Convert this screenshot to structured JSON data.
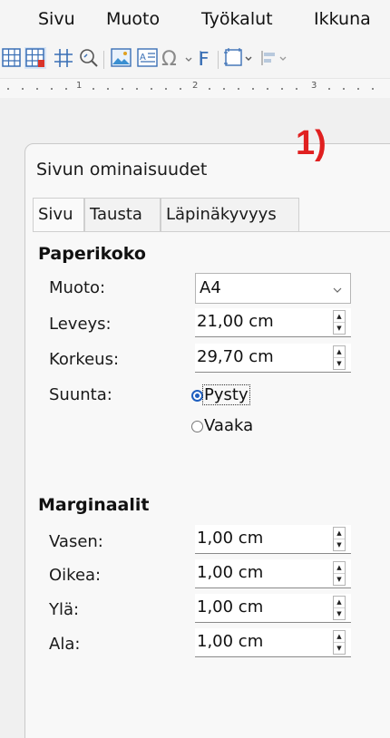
{
  "menubar": {
    "items": [
      "Sivu",
      "Muoto",
      "Työkalut",
      "Ikkuna"
    ]
  },
  "toolbar": {
    "icons": [
      "table-grid-icon",
      "table-grid-highlight-icon",
      "grid-hash-icon",
      "zoom-icon",
      "insert-image-icon",
      "text-box-icon",
      "special-character-icon",
      "fontwork-icon",
      "frame-icon",
      "align-icon"
    ]
  },
  "ruler": {
    "numbers": [
      "1",
      "2",
      "3"
    ]
  },
  "annotation": {
    "text": "1)",
    "color": "#e02020"
  },
  "dialog": {
    "title": "Sivun ominaisuudet",
    "tabs": [
      {
        "label": "Sivu",
        "active": true
      },
      {
        "label": "Tausta",
        "active": false
      },
      {
        "label": "Läpinäkyvyys",
        "active": false
      }
    ],
    "paper": {
      "title": "Paperikoko",
      "format_label": "Muoto:",
      "format_value": "A4",
      "width_label": "Leveys:",
      "width_value": "21,00 cm",
      "height_label": "Korkeus:",
      "height_value": "29,70 cm",
      "orientation_label": "Suunta:",
      "portrait_label": "Pysty",
      "landscape_label": "Vaaka",
      "selected_orientation": "Pysty"
    },
    "margins": {
      "title": "Marginaalit",
      "left_label": "Vasen:",
      "left_value": "1,00 cm",
      "right_label": "Oikea:",
      "right_value": "1,00 cm",
      "top_label": "Ylä:",
      "top_value": "1,00 cm",
      "bottom_label": "Ala:",
      "bottom_value": "1,00 cm"
    }
  }
}
